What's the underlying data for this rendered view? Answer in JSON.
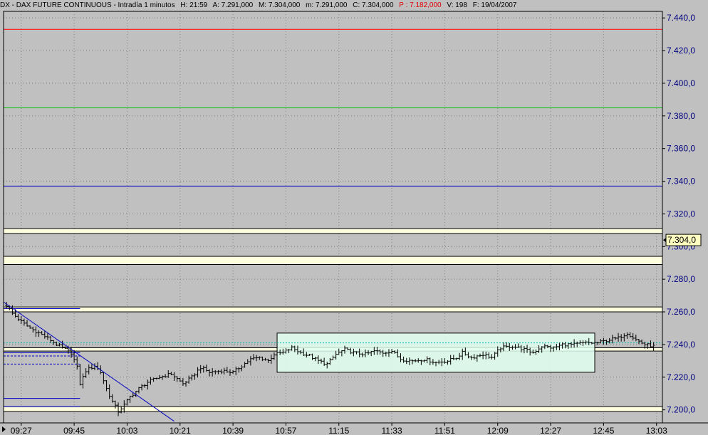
{
  "header": {
    "symbol": "DX",
    "title": "DX - DAX FUTURE CONTINUOUS - Intradía 1 minutos",
    "hour": "H: 21:59",
    "open": "A: 7.291,000",
    "max": "M: 7.304,000",
    "min": "m: 7.291,000",
    "close": "C: 7.304,000",
    "prev": "P : 7.182,000",
    "volume": "V: 198",
    "date": "F: 19/04/2007"
  },
  "colors": {
    "background": "#c0c0c0",
    "grid": "#808080",
    "price_text": "#000080",
    "candle": "#000000",
    "red_level": "#ff0000",
    "green_level": "#00c000",
    "blue_level": "#0000c0",
    "zone_fill": "#ffffe0",
    "range_box_fill": "#e0fff0",
    "dotted_line": "#00bbbb",
    "label_bg": "#ffffc0"
  },
  "chart_data": {
    "type": "ohlc-bar",
    "title": "DX - DAX FUTURE CONTINUOUS - Intradía 1 minutos",
    "timeframe_minutes": 1,
    "ylim": [
      7192,
      7444
    ],
    "y_ticks": [
      7200,
      7220,
      7240,
      7260,
      7280,
      7300,
      7320,
      7340,
      7360,
      7380,
      7400,
      7420,
      7440
    ],
    "y_tick_labels": [
      "7.200,0",
      "7.220,0",
      "7.240,0",
      "7.260,0",
      "7.280,0",
      "7.300,0",
      "7.320,0",
      "7.340,0",
      "7.360,0",
      "7.380,0",
      "7.400,0",
      "7.420,0",
      "7.440,0"
    ],
    "x_ticks": [
      "09:27",
      "09:45",
      "10:03",
      "10:21",
      "10:39",
      "10:57",
      "11:15",
      "11:33",
      "11:51",
      "12:09",
      "12:27",
      "12:45",
      "13:03"
    ],
    "x_range": [
      "09:21",
      "13:05"
    ],
    "last_price_label": "7.304,0",
    "last_price": 7304,
    "price_path": [
      [
        "09:22",
        7264
      ],
      [
        "09:24",
        7259
      ],
      [
        "09:27",
        7254
      ],
      [
        "09:30",
        7250
      ],
      [
        "09:33",
        7247
      ],
      [
        "09:36",
        7244
      ],
      [
        "09:39",
        7240
      ],
      [
        "09:42",
        7237
      ],
      [
        "09:44",
        7235
      ],
      [
        "09:46",
        7226
      ],
      [
        "09:47",
        7216
      ],
      [
        "09:49",
        7224
      ],
      [
        "09:52",
        7227
      ],
      [
        "09:54",
        7223
      ],
      [
        "09:56",
        7213
      ],
      [
        "09:58",
        7205
      ],
      [
        "10:00",
        7199
      ],
      [
        "10:02",
        7203
      ],
      [
        "10:04",
        7208
      ],
      [
        "10:07",
        7213
      ],
      [
        "10:10",
        7217
      ],
      [
        "10:14",
        7220
      ],
      [
        "10:18",
        7222
      ],
      [
        "10:22",
        7216
      ],
      [
        "10:25",
        7220
      ],
      [
        "10:28",
        7226
      ],
      [
        "10:31",
        7223
      ],
      [
        "10:35",
        7224
      ],
      [
        "10:39",
        7223
      ],
      [
        "10:42",
        7227
      ],
      [
        "10:45",
        7231
      ],
      [
        "10:48",
        7232
      ],
      [
        "10:51",
        7230
      ],
      [
        "10:53",
        7234
      ],
      [
        "10:56",
        7235
      ],
      [
        "10:59",
        7238
      ],
      [
        "11:02",
        7235
      ],
      [
        "11:05",
        7233
      ],
      [
        "11:08",
        7230
      ],
      [
        "11:11",
        7228
      ],
      [
        "11:14",
        7234
      ],
      [
        "11:17",
        7237
      ],
      [
        "11:20",
        7235
      ],
      [
        "11:24",
        7234
      ],
      [
        "11:27",
        7236
      ],
      [
        "11:30",
        7235
      ],
      [
        "11:33",
        7236
      ],
      [
        "11:36",
        7231
      ],
      [
        "11:40",
        7230
      ],
      [
        "11:44",
        7231
      ],
      [
        "11:48",
        7229
      ],
      [
        "11:52",
        7230
      ],
      [
        "11:55",
        7232
      ],
      [
        "11:57",
        7235
      ],
      [
        "12:00",
        7232
      ],
      [
        "12:04",
        7234
      ],
      [
        "12:07",
        7232
      ],
      [
        "12:10",
        7238
      ],
      [
        "12:14",
        7239
      ],
      [
        "12:18",
        7237
      ],
      [
        "12:21",
        7235
      ],
      [
        "12:24",
        7239
      ],
      [
        "12:28",
        7238
      ],
      [
        "12:31",
        7240
      ],
      [
        "12:35",
        7240
      ],
      [
        "12:39",
        7241
      ],
      [
        "12:43",
        7241
      ],
      [
        "12:47",
        7243
      ],
      [
        "12:50",
        7244
      ],
      [
        "12:53",
        7247
      ],
      [
        "12:56",
        7243
      ],
      [
        "12:59",
        7240
      ],
      [
        "13:02",
        7239
      ]
    ],
    "horizontal_lines": [
      {
        "level": 7433,
        "color": "#ff0000"
      },
      {
        "level": 7385,
        "color": "#00c000"
      },
      {
        "level": 7337,
        "color": "#0000c0"
      }
    ],
    "zones": [
      {
        "low": 7308,
        "high": 7311
      },
      {
        "low": 7289,
        "high": 7294
      },
      {
        "low": 7260,
        "high": 7263
      },
      {
        "low": 7236,
        "high": 7238
      },
      {
        "low": 7199,
        "high": 7202
      }
    ],
    "dotted_lines": [
      {
        "level": 7241,
        "color": "#00bbbb"
      }
    ],
    "short_lines": [
      {
        "level": 7262,
        "from": "09:21",
        "to": "09:47",
        "style": "solid"
      },
      {
        "level": 7235,
        "from": "09:21",
        "to": "09:47",
        "style": "solid"
      },
      {
        "level": 7233,
        "from": "09:21",
        "to": "09:47",
        "style": "dashed"
      },
      {
        "level": 7228,
        "from": "09:21",
        "to": "09:47",
        "style": "dashed"
      },
      {
        "level": 7207,
        "from": "09:21",
        "to": "09:47",
        "style": "solid"
      },
      {
        "level": 7202,
        "from": "09:21",
        "to": "09:47",
        "style": "solid"
      }
    ],
    "trend_line": {
      "from": [
        "09:21",
        7266
      ],
      "to": [
        "10:19",
        7193
      ]
    },
    "range_box": {
      "from": "10:54",
      "to": "12:42",
      "low": 7223,
      "high": 7247
    }
  }
}
